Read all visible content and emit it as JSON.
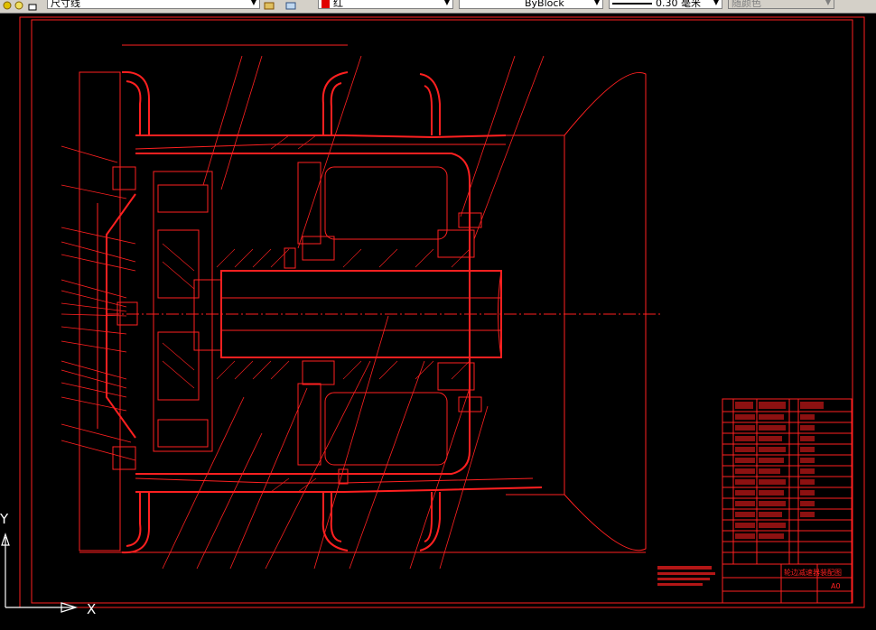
{
  "toolbar": {
    "layer_label": "尺寸线",
    "color_label": "红",
    "linetype_label": "ByBlock",
    "lineweight_label": "0.30 毫米",
    "plotstyle_label": "随颜色"
  },
  "ucs": {
    "x_label": "X",
    "y_label": "Y"
  },
  "title_block": {
    "title": "轮边减速器",
    "subtitle": "装配图",
    "sheet": "A0"
  },
  "colors": {
    "drawing": "#ff2020",
    "background": "#000000",
    "ucs": "#ffffff"
  }
}
